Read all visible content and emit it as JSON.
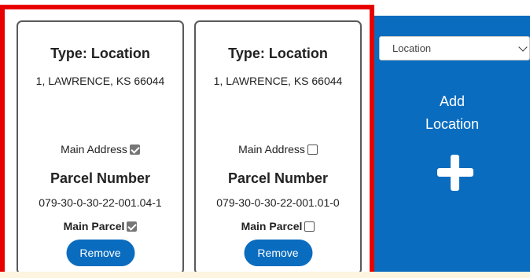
{
  "cards": [
    {
      "type_label": "Type: Location",
      "address": "1, LAWRENCE, KS 66044",
      "main_address_label": "Main Address",
      "main_address_checked": true,
      "parcel_title": "Parcel Number",
      "parcel_number": "079-30-0-30-22-001.04-1",
      "main_parcel_label": "Main Parcel",
      "main_parcel_checked": true,
      "remove_label": "Remove"
    },
    {
      "type_label": "Type: Location",
      "address": "1, LAWRENCE, KS 66044",
      "main_address_label": "Main Address",
      "main_address_checked": false,
      "parcel_title": "Parcel Number",
      "parcel_number": "079-30-0-30-22-001.01-0",
      "main_parcel_label": "Main Parcel",
      "main_parcel_checked": false,
      "remove_label": "Remove"
    }
  ],
  "add_panel": {
    "select_value": "Location",
    "add_label_line1": "Add",
    "add_label_line2": "Location",
    "icon": "plus-icon"
  },
  "colors": {
    "accent": "#0a6cbf",
    "highlight_border": "#e80000",
    "checkbox_checked": "#767676"
  }
}
